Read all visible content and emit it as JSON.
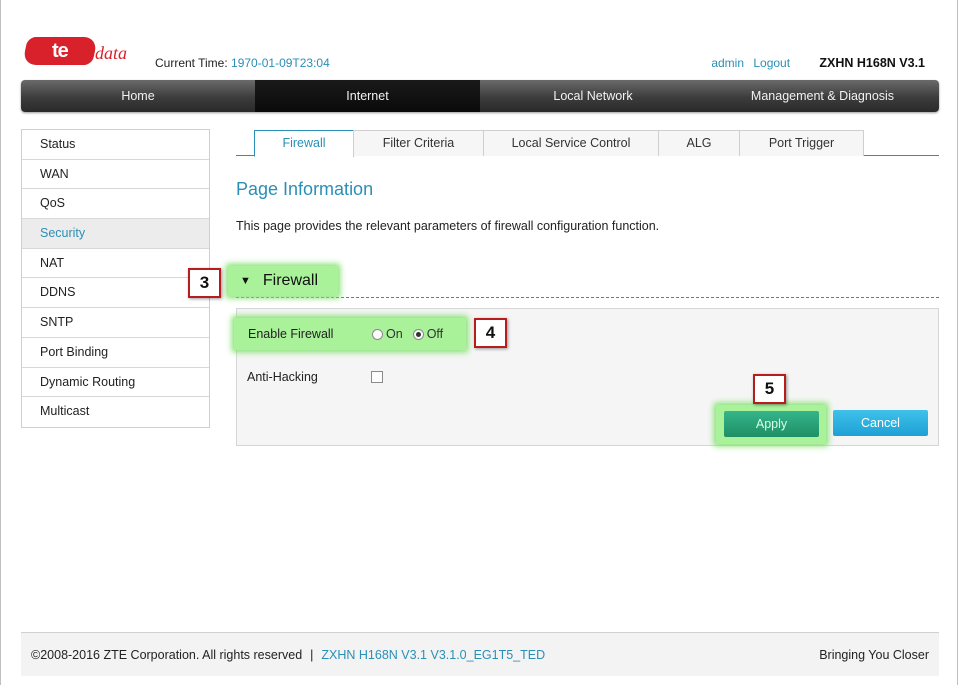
{
  "header": {
    "logo_badge": "te",
    "logo_word": "data",
    "current_time_label": "Current Time:",
    "current_time_value": "1970-01-09T23:04",
    "user": "admin",
    "logout": "Logout",
    "model": "ZXHN H168N V3.1"
  },
  "nav": {
    "items": [
      {
        "label": "Home"
      },
      {
        "label": "Internet"
      },
      {
        "label": "Local Network"
      },
      {
        "label": "Management & Diagnosis"
      }
    ],
    "active": "Internet"
  },
  "sidebar": {
    "items": [
      {
        "label": "Status"
      },
      {
        "label": "WAN"
      },
      {
        "label": "QoS"
      },
      {
        "label": "Security"
      },
      {
        "label": "NAT"
      },
      {
        "label": "DDNS"
      },
      {
        "label": "SNTP"
      },
      {
        "label": "Port Binding"
      },
      {
        "label": "Dynamic Routing"
      },
      {
        "label": "Multicast"
      }
    ],
    "active": "Security"
  },
  "tabs": {
    "items": [
      {
        "label": "Firewall"
      },
      {
        "label": "Filter Criteria"
      },
      {
        "label": "Local Service Control"
      },
      {
        "label": "ALG"
      },
      {
        "label": "Port Trigger"
      }
    ],
    "active": "Firewall"
  },
  "main": {
    "page_title": "Page Information",
    "page_desc": "This page provides the relevant parameters of firewall configuration function.",
    "section_title": "Firewall",
    "enable_firewall_label": "Enable Firewall",
    "radio_on": "On",
    "radio_off": "Off",
    "radio_selected": "Off",
    "anti_hacking_label": "Anti-Hacking",
    "anti_hacking_checked": false,
    "apply_label": "Apply",
    "cancel_label": "Cancel"
  },
  "callouts": {
    "c3": "3",
    "c4": "4",
    "c5": "5"
  },
  "footer": {
    "copyright": "©2008-2016 ZTE Corporation. All rights reserved",
    "separator": "|",
    "version": "ZXHN H168N V3.1 V3.1.0_EG1T5_TED",
    "slogan": "Bringing You Closer"
  },
  "colors": {
    "accent": "#2a8fb7",
    "brand_red": "#d9212c",
    "highlight_green": "#a9f29a",
    "apply_green": "#1f8f66",
    "cancel_blue": "#1ea0d6",
    "callout_border": "#b81d1d"
  }
}
